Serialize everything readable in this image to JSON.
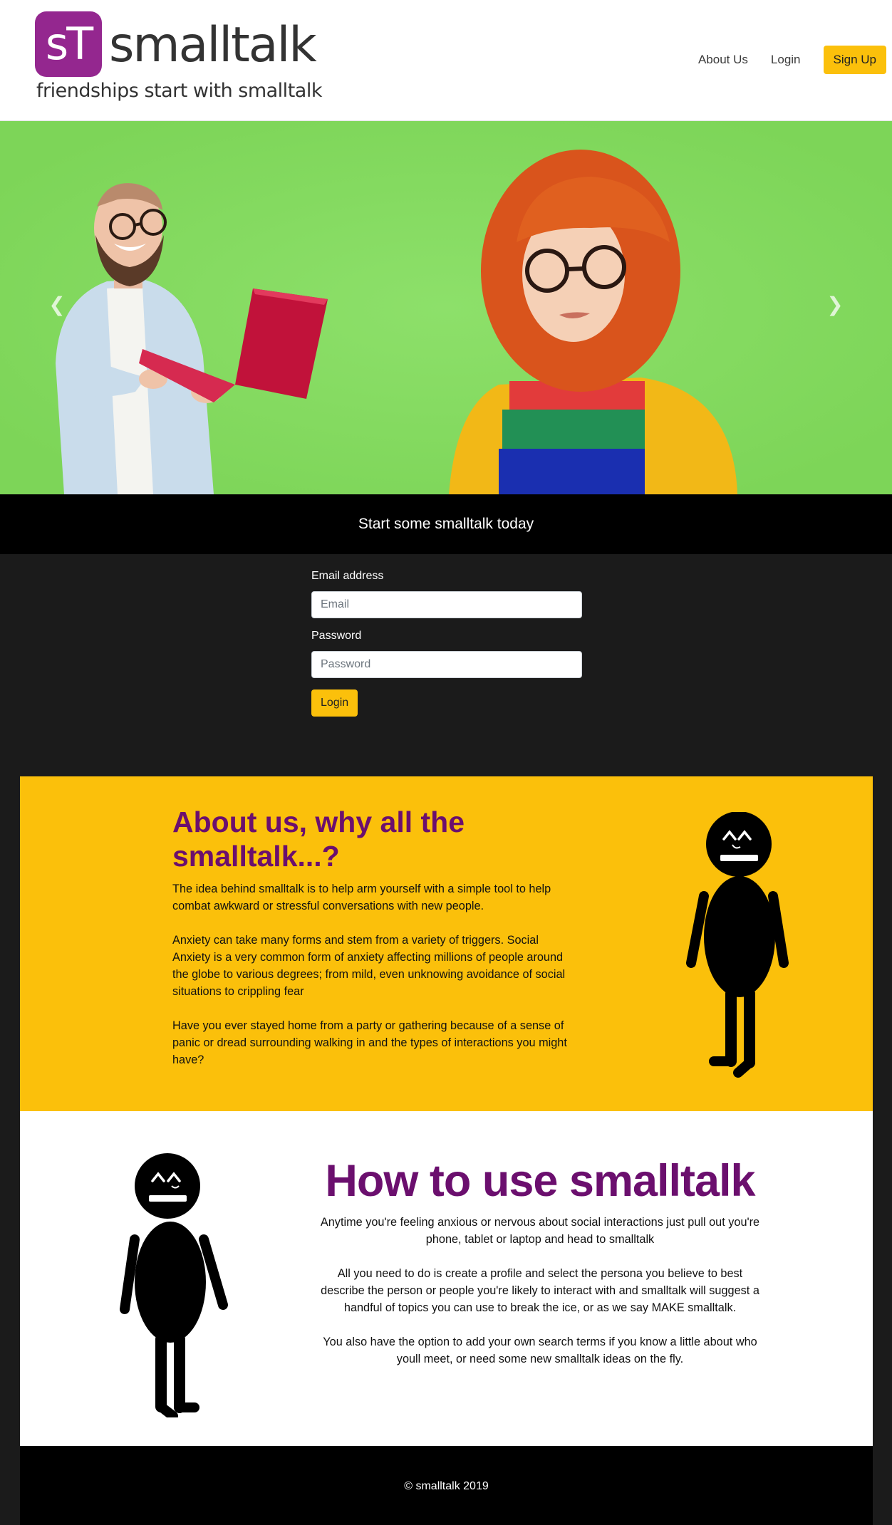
{
  "header": {
    "logo_badge": "sT",
    "logo_name": "smalltalk",
    "logo_tagline": "friendships start with smalltalk",
    "nav": {
      "about": "About Us",
      "login": "Login",
      "signup": "Sign Up"
    }
  },
  "hero": {
    "prev_icon": "chevron-left-icon",
    "next_icon": "chevron-right-icon",
    "prev_glyph": "❮",
    "next_glyph": "❯"
  },
  "banner": {
    "text": "Start some smalltalk today"
  },
  "login_form": {
    "email_label": "Email address",
    "email_placeholder": "Email",
    "password_label": "Password",
    "password_placeholder": "Password",
    "submit_label": "Login"
  },
  "about": {
    "title": "About us, why all the smalltalk...?",
    "paragraphs": [
      "The idea behind smalltalk is to help arm yourself with a simple tool to help combat awkward or stressful conversations with new people.",
      "Anxiety can take many forms and stem from a variety of triggers. Social Anxiety is a very common form of anxiety affecting millions of people around the globe to various degrees; from mild, even unknowing avoidance of social situations to crippling fear",
      "Have you ever stayed home from a party or gathering because of a sense of panic or dread surrounding walking in and the types of interactions you might have?"
    ]
  },
  "howto": {
    "title": "How to use smalltalk",
    "paragraphs": [
      "Anytime you're feeling anxious or nervous about social interactions just pull out you're phone, tablet or laptop and head to smalltalk",
      "All you need to do is create a profile and select the persona you believe to best describe the person or people you're likely to interact with and smalltalk will suggest a handful of topics you can use to break the ice, or as we say MAKE smalltalk.",
      "You also have the option to add your own search terms if you know a little about who youll meet, or need some new smalltalk ideas on the fly."
    ]
  },
  "footer": {
    "text": "© smalltalk 2019"
  },
  "colors": {
    "brand_purple": "#94278f",
    "heading_purple": "#6b0f6e",
    "accent_yellow": "#fbc00b",
    "hero_green": "#83d95f"
  }
}
